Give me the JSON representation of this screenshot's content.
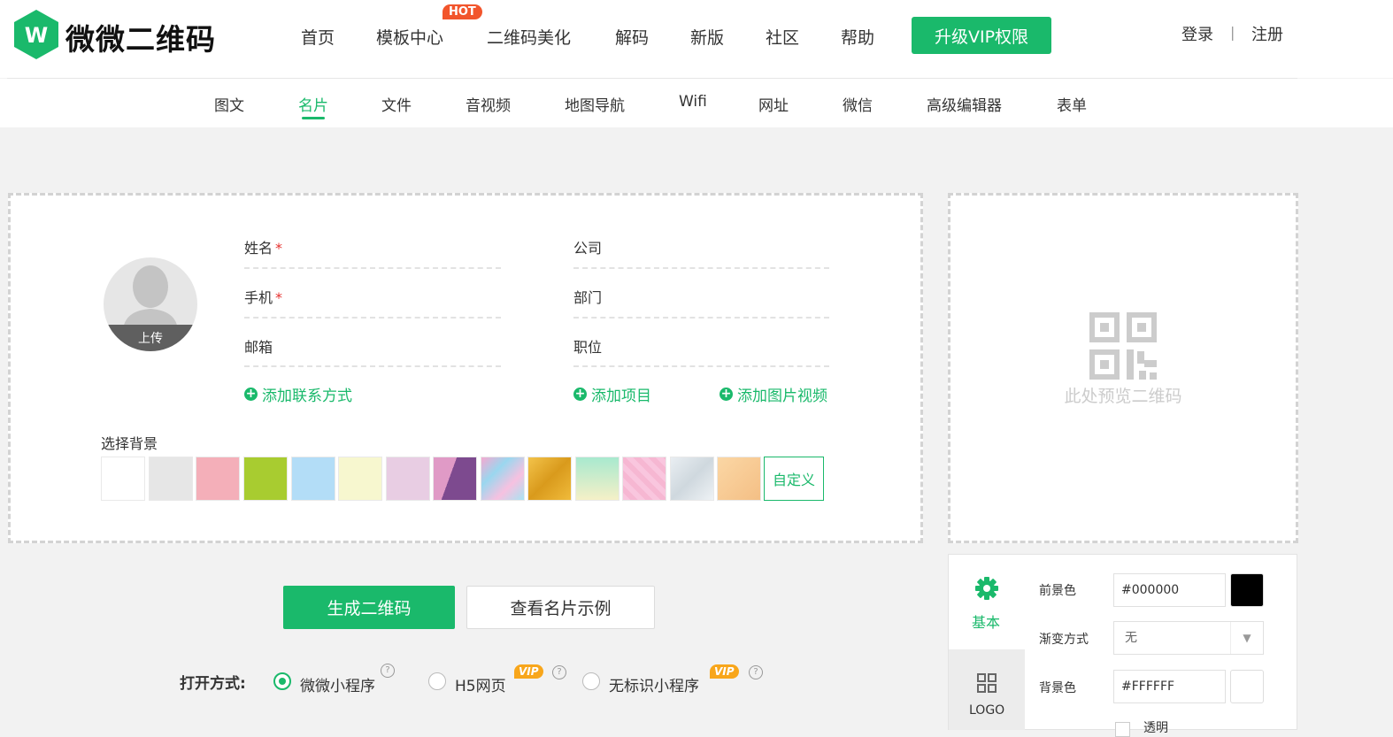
{
  "brand": {
    "name": "微微二维码",
    "color": "#1ab96b"
  },
  "nav": {
    "items": [
      "首页",
      "模板中心",
      "二维码美化",
      "解码",
      "新版",
      "社区",
      "帮助"
    ],
    "hot_badge": "HOT",
    "vip_button": "升级VIP权限",
    "login": "登录",
    "separator": "|",
    "register": "注册"
  },
  "subnav": {
    "items": [
      "图文",
      "名片",
      "文件",
      "音视频",
      "地图导航",
      "Wifi",
      "网址",
      "微信",
      "高级编辑器",
      "表单"
    ],
    "active": "名片"
  },
  "form": {
    "avatar_label": "上传",
    "fields": {
      "name": "姓名",
      "phone": "手机",
      "email": "邮箱",
      "company": "公司",
      "department": "部门",
      "position": "职位"
    },
    "required_mark": "*",
    "add_contact": "添加联系方式",
    "add_item": "添加项目",
    "add_media": "添加图片视频",
    "background_title": "选择背景",
    "custom_bg": "自定义",
    "swatches": [
      "#ffffff",
      "#e6e6e6",
      "#f4afb9",
      "#a8cc30",
      "#b3ddf7",
      "#f7f7cf",
      "#e8cde3",
      "purple-diagonal",
      "marble",
      "gold",
      "mint-gradient",
      "pink-pattern",
      "silver",
      "peach"
    ]
  },
  "preview": {
    "placeholder": "此处预览二维码",
    "icon": "qr-code-icon"
  },
  "actions": {
    "generate": "生成二维码",
    "sample": "查看名片示例"
  },
  "open_mode": {
    "title": "打开方式:",
    "options": [
      {
        "label": "微微小程序",
        "selected": true,
        "vip": false
      },
      {
        "label": "H5网页",
        "selected": false,
        "vip": true
      },
      {
        "label": "无标识小程序",
        "selected": false,
        "vip": true
      }
    ],
    "vip_tag": "VIP",
    "help_glyph": "?"
  },
  "settings": {
    "tabs": [
      {
        "label": "基本",
        "icon": "gear-icon"
      },
      {
        "label": "LOGO",
        "icon": "grid-icon"
      }
    ],
    "foreground_label": "前景色",
    "foreground_value": "#000000",
    "gradient_label": "渐变方式",
    "gradient_value": "无",
    "background_label": "背景色",
    "background_value": "#FFFFFF",
    "transparent_label": "透明"
  }
}
